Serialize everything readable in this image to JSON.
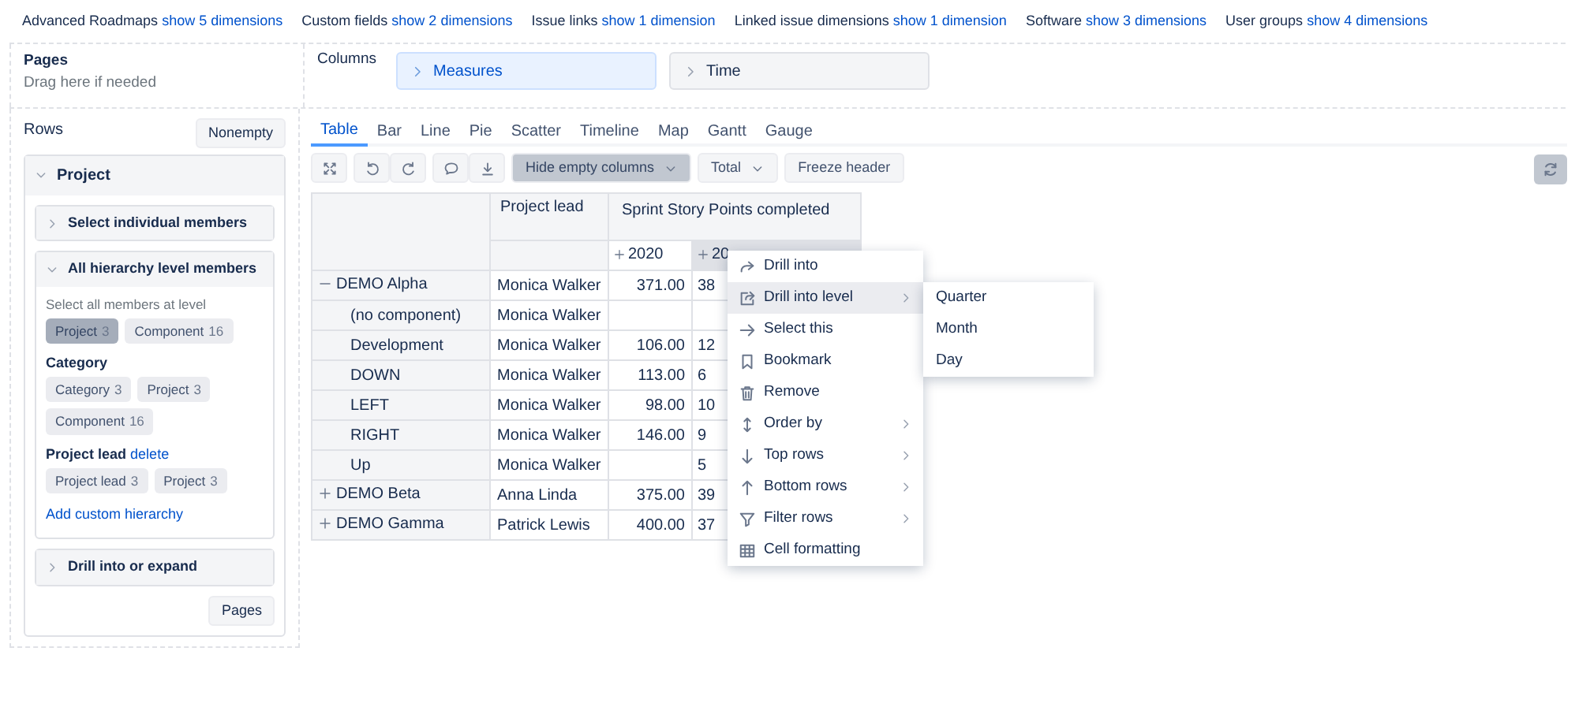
{
  "dimension_bar": [
    {
      "label": "Advanced Roadmaps",
      "link": "show 5 dimensions"
    },
    {
      "label": "Custom fields",
      "link": "show 2 dimensions"
    },
    {
      "label": "Issue links",
      "link": "show 1 dimension"
    },
    {
      "label": "Linked issue dimensions",
      "link": "show 1 dimension"
    },
    {
      "label": "Software",
      "link": "show 3 dimensions"
    },
    {
      "label": "User groups",
      "link": "show 4 dimensions"
    }
  ],
  "pages": {
    "title": "Pages",
    "hint": "Drag here if needed"
  },
  "columns": {
    "title": "Columns",
    "items": [
      {
        "label": "Measures",
        "selected": true
      },
      {
        "label": "Time",
        "selected": false
      }
    ]
  },
  "rows_panel": {
    "title": "Rows",
    "nonempty_button": "Nonempty",
    "dimension": {
      "title": "Project",
      "expanded": true,
      "sections": [
        {
          "title": "Select individual members",
          "expanded": false
        },
        {
          "title": "All hierarchy level members",
          "expanded": true,
          "hint": "Select all members at level",
          "groups": [
            {
              "chips": [
                {
                  "label": "Project",
                  "count": "3",
                  "selected": true
                },
                {
                  "label": "Component",
                  "count": "16",
                  "selected": false
                }
              ]
            },
            {
              "title": "Category",
              "chips": [
                {
                  "label": "Category",
                  "count": "3",
                  "selected": false
                },
                {
                  "label": "Project",
                  "count": "3",
                  "selected": false
                },
                {
                  "label": "Component",
                  "count": "16",
                  "selected": false
                }
              ]
            },
            {
              "title": "Project lead",
              "action": "delete",
              "chips": [
                {
                  "label": "Project lead",
                  "count": "3",
                  "selected": false
                },
                {
                  "label": "Project",
                  "count": "3",
                  "selected": false
                }
              ]
            }
          ],
          "add_link": "Add custom hierarchy"
        },
        {
          "title": "Drill into or expand",
          "expanded": false
        }
      ]
    },
    "pages_button": "Pages"
  },
  "tabs": [
    {
      "label": "Table",
      "selected": true
    },
    {
      "label": "Bar",
      "selected": false
    },
    {
      "label": "Line",
      "selected": false
    },
    {
      "label": "Pie",
      "selected": false
    },
    {
      "label": "Scatter",
      "selected": false
    },
    {
      "label": "Timeline",
      "selected": false
    },
    {
      "label": "Map",
      "selected": false
    },
    {
      "label": "Gantt",
      "selected": false
    },
    {
      "label": "Gauge",
      "selected": false
    }
  ],
  "toolbar": {
    "dropdowns": [
      {
        "label": "Hide empty columns",
        "active": true
      },
      {
        "label": "Total",
        "active": false
      }
    ],
    "freeze_button": "Freeze header"
  },
  "table": {
    "lead_header": "Project lead",
    "measure_header": "Sprint Story Points completed",
    "years": [
      {
        "label": "2020",
        "selected": false
      },
      {
        "label": "20",
        "selected": true
      }
    ],
    "rows": [
      {
        "name": "DEMO Alpha",
        "kind": "parent",
        "expanded": true,
        "lead": "Monica Walker",
        "first_year": "371.00",
        "second_year": "38"
      },
      {
        "name": "(no component)",
        "kind": "child",
        "lead": "Monica Walker"
      },
      {
        "name": "Development",
        "kind": "child",
        "lead": "Monica Walker",
        "first_year": "106.00",
        "second_year": "12"
      },
      {
        "name": "DOWN",
        "kind": "child",
        "lead": "Monica Walker",
        "first_year": "113.00",
        "second_year": "6"
      },
      {
        "name": "LEFT",
        "kind": "child",
        "lead": "Monica Walker",
        "first_year": "98.00",
        "second_year": "10"
      },
      {
        "name": "RIGHT",
        "kind": "child",
        "lead": "Monica Walker",
        "first_year": "146.00",
        "second_year": "9"
      },
      {
        "name": "Up",
        "kind": "child",
        "lead": "Monica Walker",
        "second_year": "5"
      },
      {
        "name": "DEMO Beta",
        "kind": "parent",
        "expanded": false,
        "lead": "Anna Linda",
        "first_year": "375.00",
        "second_year": "39"
      },
      {
        "name": "DEMO Gamma",
        "kind": "parent",
        "expanded": false,
        "lead": "Patrick Lewis",
        "first_year": "400.00",
        "second_year": "37"
      }
    ]
  },
  "context_menu": {
    "items": [
      {
        "label": "Drill into",
        "kind": "share",
        "submenu": false,
        "selected": false
      },
      {
        "label": "Drill into level",
        "kind": "share-box",
        "submenu": true,
        "selected": true
      },
      {
        "label": "Select this",
        "kind": "arrow-right",
        "submenu": false,
        "selected": false
      },
      {
        "label": "Bookmark",
        "kind": "bookmark",
        "submenu": false,
        "selected": false
      },
      {
        "label": "Remove",
        "kind": "trash",
        "submenu": false,
        "selected": false
      },
      {
        "label": "Order by",
        "kind": "sort",
        "submenu": true,
        "selected": false
      },
      {
        "label": "Top rows",
        "kind": "arrow-down",
        "submenu": true,
        "selected": false
      },
      {
        "label": "Bottom rows",
        "kind": "arrow-up",
        "submenu": true,
        "selected": false
      },
      {
        "label": "Filter rows",
        "kind": "filter",
        "submenu": true,
        "selected": false
      },
      {
        "label": "Cell formatting",
        "kind": "grid",
        "submenu": false,
        "selected": false
      }
    ],
    "submenu": [
      "Quarter",
      "Month",
      "Day"
    ]
  }
}
